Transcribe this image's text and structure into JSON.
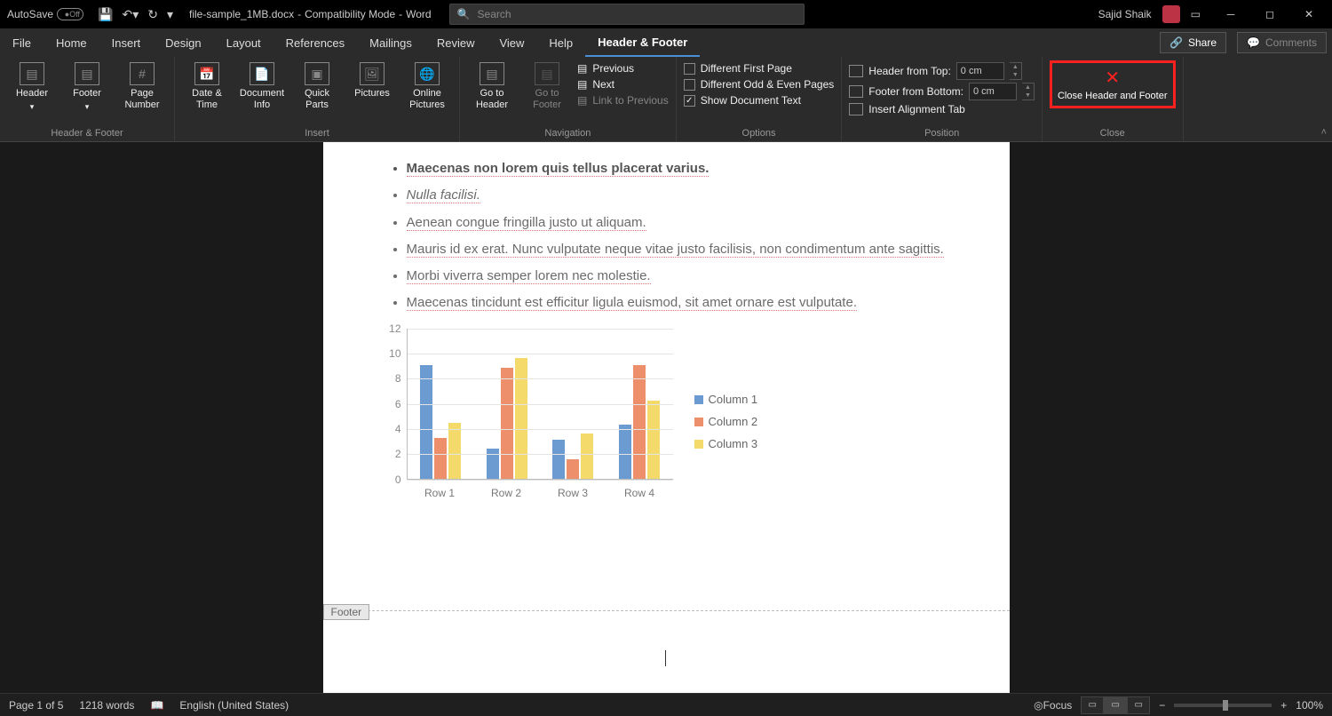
{
  "title": {
    "autosave": "AutoSave",
    "autosave_state": "Off",
    "filename": "file-sample_1MB.docx",
    "mode": "Compatibility Mode",
    "app": "Word",
    "search_placeholder": "Search",
    "user": "Sajid Shaik"
  },
  "tabs": {
    "file": "File",
    "home": "Home",
    "insert": "Insert",
    "design": "Design",
    "layout": "Layout",
    "references": "References",
    "mailings": "Mailings",
    "review": "Review",
    "view": "View",
    "help": "Help",
    "header_footer": "Header & Footer",
    "share": "Share",
    "comments": "Comments"
  },
  "ribbon": {
    "hf_group": "Header & Footer",
    "header": "Header",
    "footer": "Footer",
    "page_number": "Page\nNumber",
    "insert_group": "Insert",
    "date_time": "Date &\nTime",
    "doc_info": "Document\nInfo",
    "quick_parts": "Quick\nParts",
    "pictures": "Pictures",
    "online_pictures": "Online\nPictures",
    "nav_group": "Navigation",
    "goto_header": "Go to\nHeader",
    "goto_footer": "Go to\nFooter",
    "previous": "Previous",
    "next": "Next",
    "link_prev": "Link to Previous",
    "options_group": "Options",
    "diff_first": "Different First Page",
    "diff_odd": "Different Odd & Even Pages",
    "show_doc": "Show Document Text",
    "position_group": "Position",
    "header_top": "Header from Top:",
    "footer_bottom": "Footer from Bottom:",
    "header_top_val": "0 cm",
    "footer_bottom_val": "0 cm",
    "insert_align": "Insert Alignment Tab",
    "close_group": "Close",
    "close_hf": "Close Header\nand Footer"
  },
  "document": {
    "bullets": [
      {
        "text": "Maecenas non lorem quis tellus placerat varius.",
        "bold": true
      },
      {
        "text": "Nulla facilisi.",
        "bold": false,
        "italic": true
      },
      {
        "text": "Aenean congue fringilla justo ut aliquam.",
        "bold": false
      },
      {
        "text": "Mauris id ex erat. Nunc vulputate neque vitae justo facilisis, non condimentum ante sagittis.",
        "bold": false
      },
      {
        "text": "Morbi viverra semper lorem nec molestie.",
        "bold": false
      },
      {
        "text": "Maecenas tincidunt est efficitur ligula euismod, sit amet ornare est vulputate.",
        "bold": false
      }
    ],
    "footer_label": "Footer"
  },
  "chart_data": {
    "type": "bar",
    "categories": [
      "Row 1",
      "Row 2",
      "Row 3",
      "Row 4"
    ],
    "series": [
      {
        "name": "Column 1",
        "values": [
          9.0,
          2.4,
          3.1,
          4.3
        ],
        "color": "#6b9bd1"
      },
      {
        "name": "Column 2",
        "values": [
          3.2,
          8.8,
          1.5,
          9.0
        ],
        "color": "#ee8f6b"
      },
      {
        "name": "Column 3",
        "values": [
          4.4,
          9.6,
          3.6,
          6.2
        ],
        "color": "#f4d96b"
      }
    ],
    "ylim": [
      0,
      12
    ],
    "yticks": [
      0,
      2,
      4,
      6,
      8,
      10,
      12
    ]
  },
  "status": {
    "page": "Page 1 of 5",
    "words": "1218 words",
    "lang": "English (United States)",
    "focus": "Focus",
    "zoom": "100%"
  }
}
